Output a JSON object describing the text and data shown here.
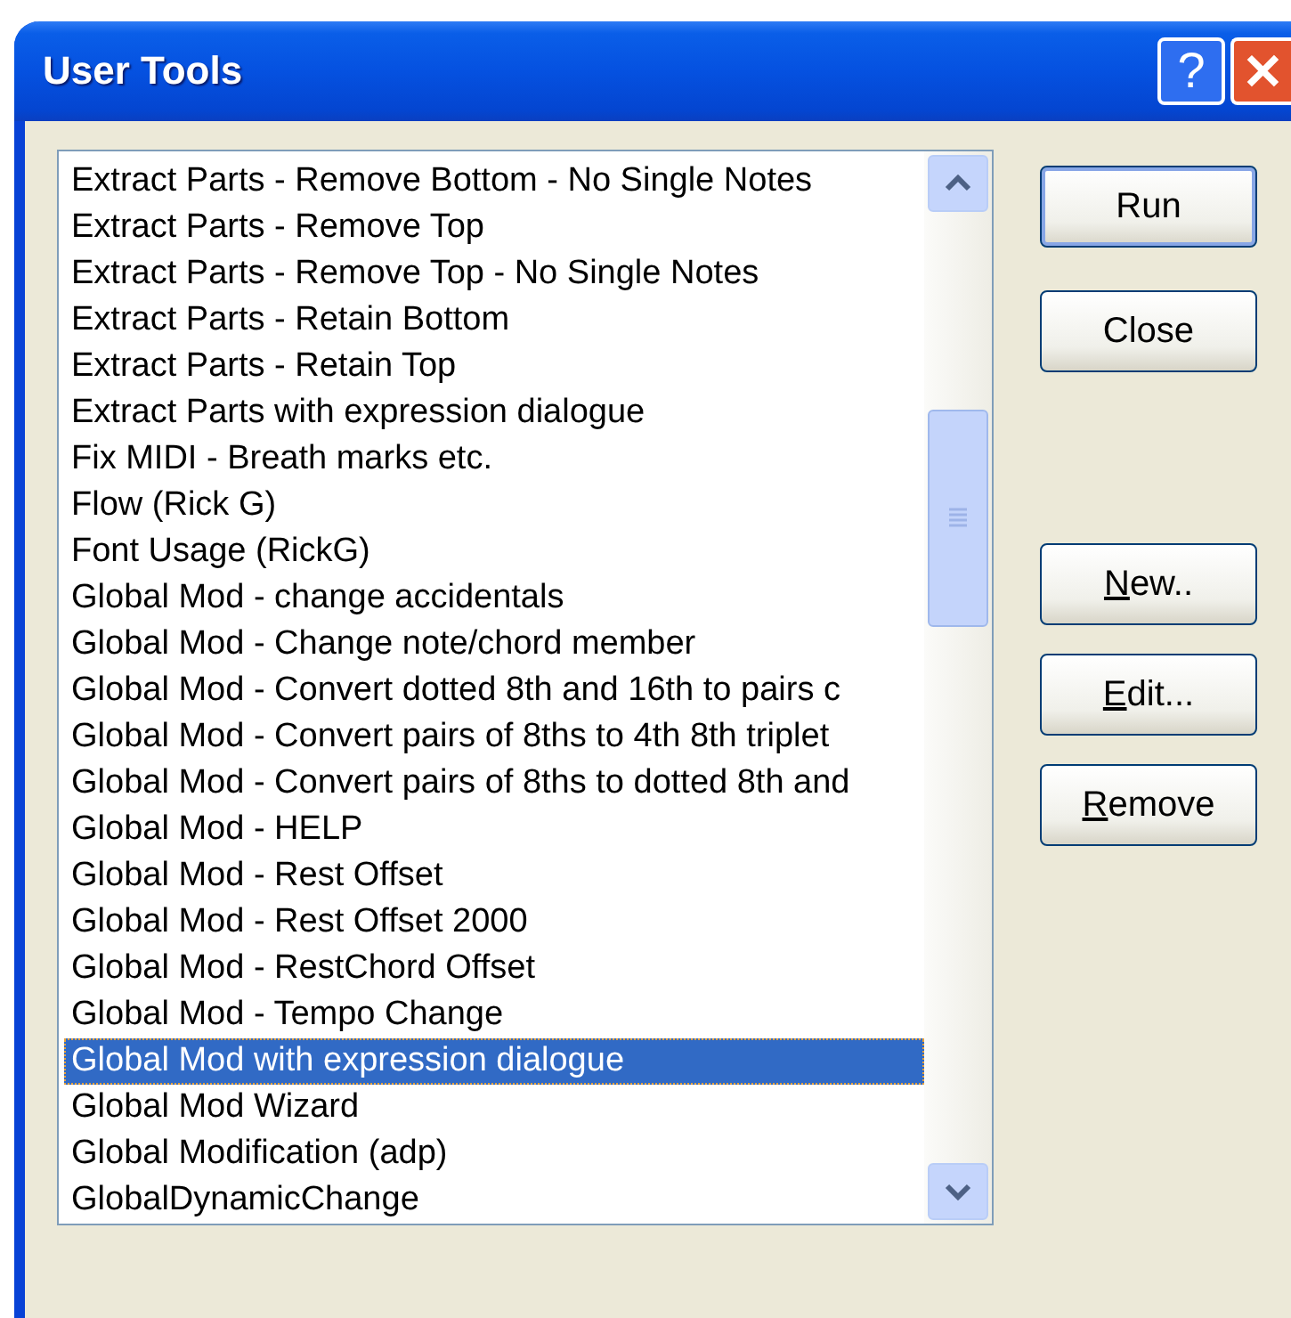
{
  "window": {
    "title": "User Tools",
    "title_buttons": [
      {
        "kind": "help",
        "label": "?"
      },
      {
        "kind": "close",
        "label": "✕"
      }
    ]
  },
  "list": {
    "items": [
      {
        "label": "Extract Parts - Remove Bottom - No Single Notes",
        "selected": false
      },
      {
        "label": "Extract Parts - Remove Top",
        "selected": false
      },
      {
        "label": "Extract Parts - Remove Top - No Single Notes",
        "selected": false
      },
      {
        "label": "Extract Parts - Retain Bottom",
        "selected": false
      },
      {
        "label": "Extract Parts - Retain Top",
        "selected": false
      },
      {
        "label": "Extract Parts with expression dialogue",
        "selected": false
      },
      {
        "label": "Fix MIDI - Breath marks etc.",
        "selected": false
      },
      {
        "label": "Flow (Rick G)",
        "selected": false
      },
      {
        "label": "Font Usage (RickG)",
        "selected": false
      },
      {
        "label": "Global Mod - change accidentals",
        "selected": false
      },
      {
        "label": "Global Mod - Change note/chord member",
        "selected": false
      },
      {
        "label": "Global Mod - Convert dotted 8th and 16th to pairs c",
        "selected": false
      },
      {
        "label": "Global Mod - Convert pairs of 8ths to 4th 8th triplet",
        "selected": false
      },
      {
        "label": "Global Mod - Convert pairs of 8ths to dotted 8th and",
        "selected": false
      },
      {
        "label": "Global Mod - HELP",
        "selected": false
      },
      {
        "label": "Global Mod - Rest Offset",
        "selected": false
      },
      {
        "label": "Global Mod - Rest Offset 2000",
        "selected": false
      },
      {
        "label": "Global Mod - RestChord Offset",
        "selected": false
      },
      {
        "label": "Global Mod - Tempo Change",
        "selected": false
      },
      {
        "label": "Global Mod with expression dialogue",
        "selected": true
      },
      {
        "label": "Global Mod Wizard",
        "selected": false
      },
      {
        "label": "Global Modification (adp)",
        "selected": false
      },
      {
        "label": "GlobalDynamicChange",
        "selected": false
      }
    ]
  },
  "button_groups": [
    {
      "buttons": [
        {
          "label": "Run",
          "default": true,
          "first_letter_underlined": false
        },
        {
          "label": "Close",
          "default": false,
          "first_letter_underlined": false
        }
      ]
    },
    {
      "buttons": [
        {
          "label": "New..",
          "default": false,
          "first_letter_underlined": true
        },
        {
          "label": "Edit...",
          "default": false,
          "first_letter_underlined": true
        },
        {
          "label": "Remove",
          "default": false,
          "first_letter_underlined": true
        }
      ]
    }
  ]
}
